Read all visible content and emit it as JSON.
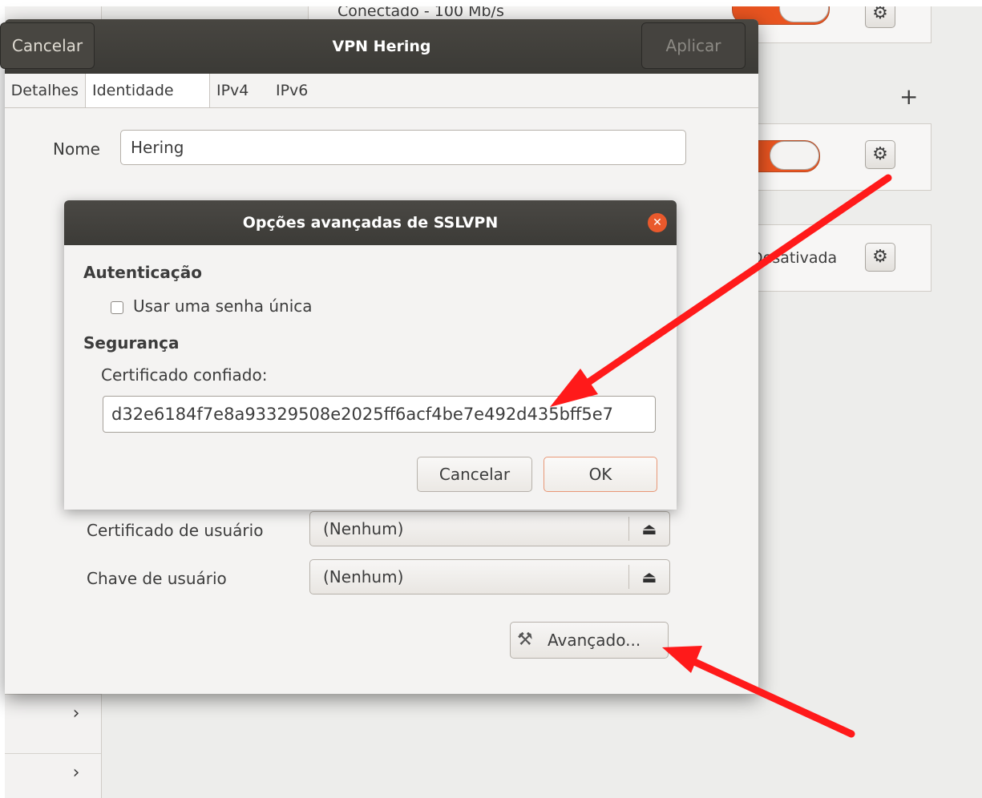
{
  "background": {
    "status_text": "Conectado - 100 Mb/s",
    "status_text_2": "Desativada",
    "plus_symbol": "+",
    "chevron": "›"
  },
  "vpn_dialog": {
    "title": "VPN Hering",
    "cancel_label": "Cancelar",
    "apply_label": "Aplicar",
    "tabs": [
      "Detalhes",
      "Identidade",
      "IPv4",
      "IPv6"
    ],
    "name_label": "Nome",
    "name_value": "Hering",
    "user_cert_label": "Certificado de usuário",
    "user_cert_value": "(Nenhum)",
    "user_key_label": "Chave de usuário",
    "user_key_value": "(Nenhum)",
    "advanced_label": "Avançado..."
  },
  "advanced_dialog": {
    "title": "Opções avançadas de SSLVPN",
    "auth_section": "Autenticação",
    "otp_checkbox_label": "Usar uma senha única",
    "otp_checked": false,
    "security_section": "Segurança",
    "trusted_cert_label": "Certificado confiado:",
    "trusted_cert_value": "d32e6184f7e8a93329508e2025ff6acf4be7e492d435bff5e7",
    "cancel_label": "Cancelar",
    "ok_label": "OK"
  },
  "colors": {
    "accent": "#e95420",
    "header_dark": "#3c3b37",
    "arrow_red": "#ff0000"
  },
  "icons": {
    "gear": "gear-icon",
    "close": "close-icon",
    "file": "file-open-icon",
    "tools": "tools-icon",
    "chevron": "chevron-right-icon"
  }
}
